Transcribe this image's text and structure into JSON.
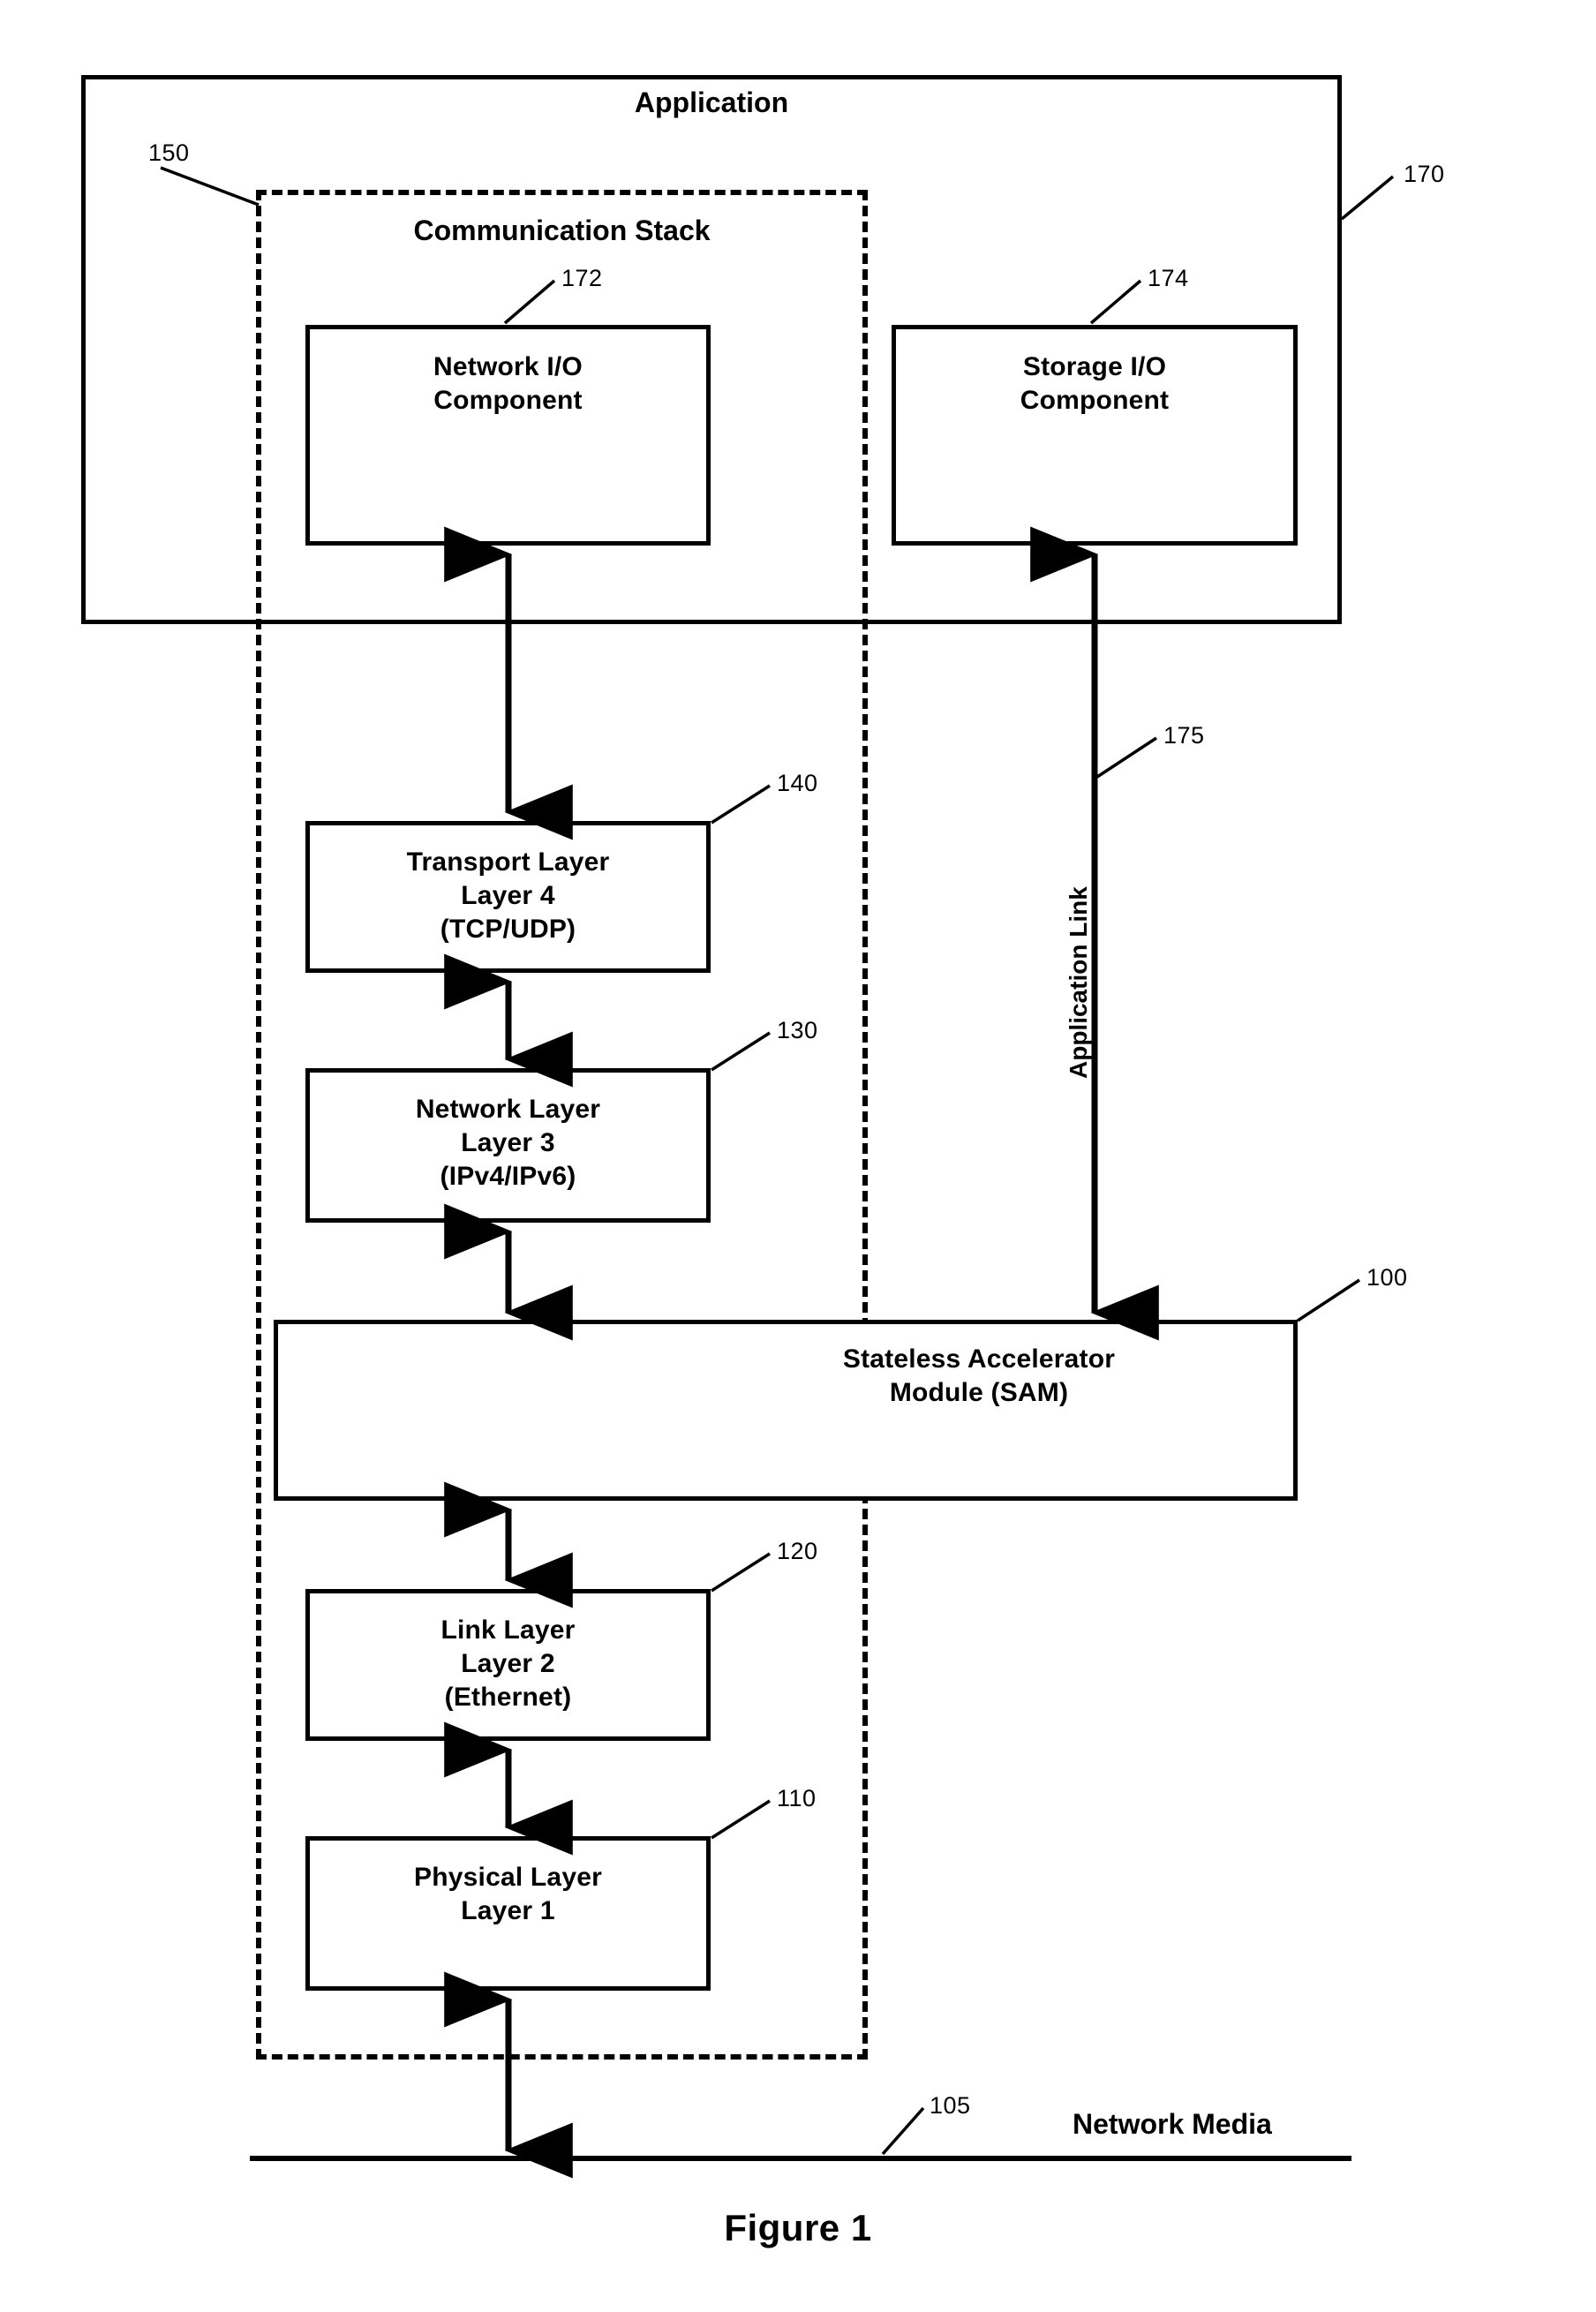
{
  "figure": {
    "caption": "Figure 1"
  },
  "application": {
    "title": "Application",
    "ref": "170"
  },
  "communication_stack": {
    "title": "Communication Stack",
    "ref": "150"
  },
  "boxes": {
    "network_io": {
      "line1": "Network I/O",
      "line2": "Component",
      "ref": "172"
    },
    "storage_io": {
      "line1": "Storage I/O",
      "line2": "Component",
      "ref": "174"
    },
    "transport_layer": {
      "line1": "Transport Layer",
      "line2": "Layer 4",
      "line3": "(TCP/UDP)",
      "ref": "140"
    },
    "network_layer": {
      "line1": "Network Layer",
      "line2": "Layer 3",
      "line3": "(IPv4/IPv6)",
      "ref": "130"
    },
    "sam": {
      "line1": "Stateless Accelerator",
      "line2": "Module (SAM)",
      "ref": "100"
    },
    "link_layer": {
      "line1": "Link Layer",
      "line2": "Layer 2",
      "line3": "(Ethernet)",
      "ref": "120"
    },
    "physical_layer": {
      "line1": "Physical Layer",
      "line2": "Layer 1",
      "ref": "110"
    }
  },
  "application_link": {
    "label": "Application Link",
    "ref": "175"
  },
  "network_media": {
    "label": "Network Media",
    "ref": "105"
  },
  "colors": {
    "ink": "#000000",
    "paper": "#ffffff"
  }
}
